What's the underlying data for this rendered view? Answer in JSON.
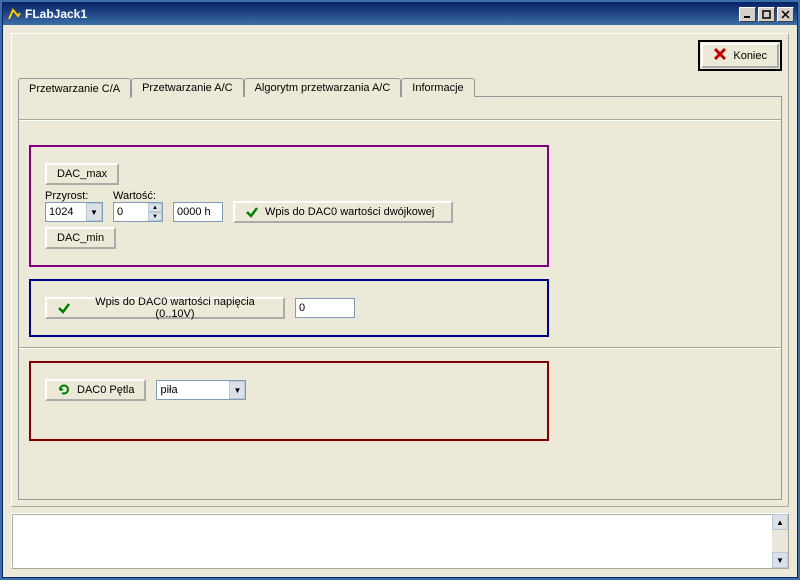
{
  "window": {
    "title": "FLabJack1"
  },
  "toolbar": {
    "koniec_label": "Koniec"
  },
  "tabs": [
    {
      "label": "Przetwarzanie C/A",
      "active": true
    },
    {
      "label": "Przetwarzanie A/C",
      "active": false
    },
    {
      "label": "Algorytm przetwarzania A/C",
      "active": false
    },
    {
      "label": "Informacje",
      "active": false
    }
  ],
  "box1": {
    "dac_max_label": "DAC_max",
    "przyrost_label": "Przyrost:",
    "wartosc_label": "Wartość:",
    "przyrost_value": "1024",
    "wartosc_value": "0",
    "hex_value": "0000 h",
    "wpis_binary_label": "Wpis do DAC0 wartości dwójkowej",
    "dac_min_label": "DAC_min"
  },
  "box2": {
    "wpis_voltage_label": "Wpis do DAC0 wartości napięcia (0..10V)",
    "voltage_value": "0"
  },
  "box3": {
    "loop_label": "DAC0 Pętla",
    "waveform_value": "piła"
  },
  "colors": {
    "purple": "#800080",
    "blue": "#000080",
    "red": "#800000",
    "check_green": "#008000"
  }
}
